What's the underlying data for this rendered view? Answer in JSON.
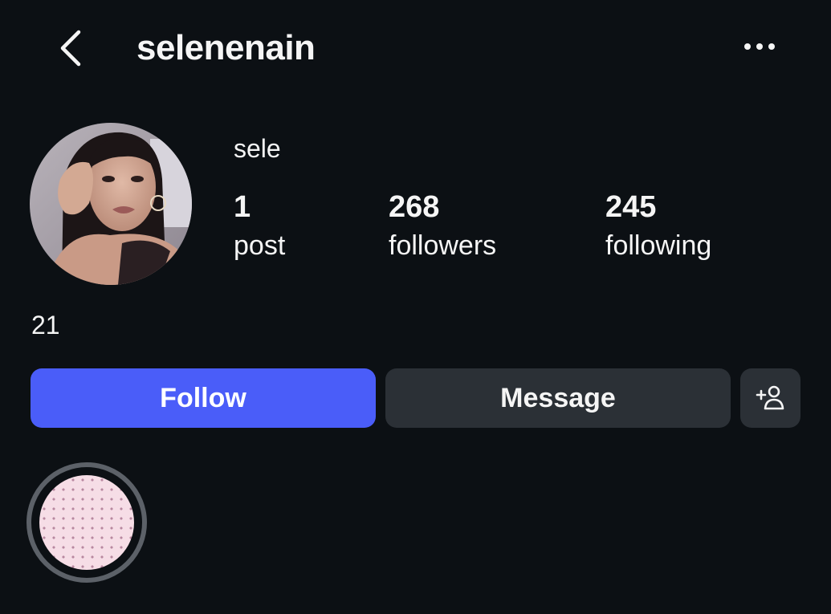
{
  "header": {
    "username": "selenenain",
    "back_icon": "chevron-left-icon",
    "more_icon": "more-horizontal-icon"
  },
  "profile": {
    "display_name": "sele",
    "bio": "21",
    "stats": {
      "posts": {
        "value": "1",
        "label": "post"
      },
      "followers": {
        "value": "268",
        "label": "followers"
      },
      "following": {
        "value": "245",
        "label": "following"
      }
    }
  },
  "actions": {
    "follow_label": "Follow",
    "message_label": "Message",
    "add_user_icon": "add-user-icon"
  },
  "colors": {
    "background": "#0c1014",
    "follow_button": "#4a5df9",
    "secondary_button": "#2b3036",
    "highlight_ring": "#5c6168",
    "highlight_fill": "#f6dde6"
  }
}
